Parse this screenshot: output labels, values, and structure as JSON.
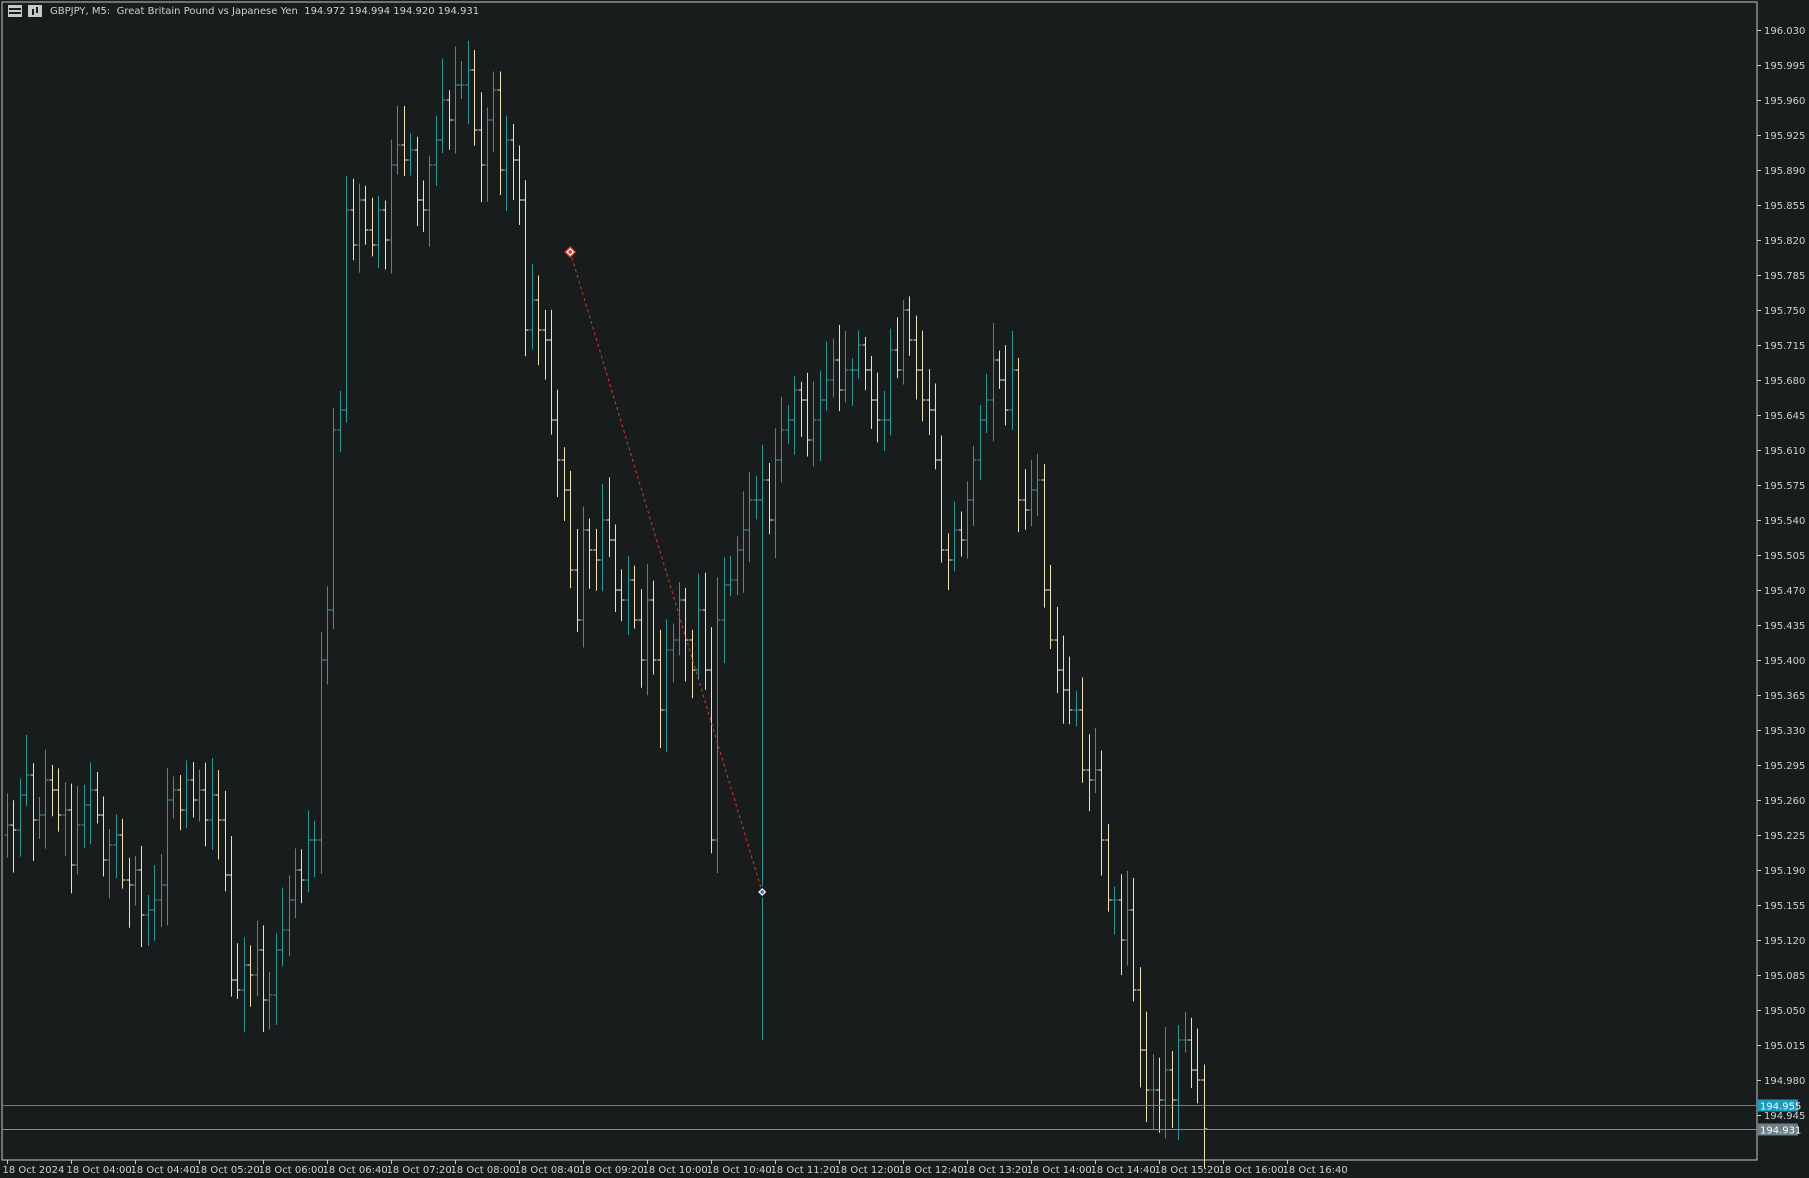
{
  "window": {
    "title": "GBPJPY, M5:  Great Britain Pound vs Japanese Yen  194.972 194.994 194.920 194.931",
    "menu_icon": "window-menu-icon",
    "chart_icon": "chart-type-icon"
  },
  "colors": {
    "background": "#181c1d",
    "axis": "#c8c8c8",
    "bull": "#2e9a94",
    "bear": "#efe3b8",
    "bid_line": "#1a9bc0",
    "ask_line": "#7f8f96",
    "bid_tag": "#1a9bc0",
    "ask_tag": "#6f7f86",
    "trade_line": "#d23a28"
  },
  "price_lines": {
    "bid": 194.955,
    "bid_label": "194.955",
    "ask": 194.931,
    "ask_label": "194.931"
  },
  "trade": {
    "open_marker": "sell-entry-icon",
    "close_marker": "exit-icon",
    "open_price": 195.808,
    "open_bar": 88,
    "close_price": 195.168,
    "close_bar": 118
  },
  "chart_data": {
    "type": "ohlc",
    "symbol": "GBPJPY",
    "timeframe": "M5",
    "ylim": [
      194.92,
      196.05
    ],
    "y_ticks": [
      "196.030",
      "195.995",
      "195.960",
      "195.925",
      "195.890",
      "195.855",
      "195.820",
      "195.785",
      "195.750",
      "195.715",
      "195.680",
      "195.645",
      "195.610",
      "195.575",
      "195.540",
      "195.505",
      "195.470",
      "195.435",
      "195.400",
      "195.365",
      "195.330",
      "195.295",
      "195.260",
      "195.225",
      "195.190",
      "195.155",
      "195.120",
      "195.085",
      "195.050",
      "195.015",
      "194.980",
      "194.945"
    ],
    "x_labels": [
      {
        "bar": 0,
        "label": "18 Oct 2024"
      },
      {
        "bar": 10,
        "label": "18 Oct 04:00"
      },
      {
        "bar": 20,
        "label": "18 Oct 04:40"
      },
      {
        "bar": 30,
        "label": "18 Oct 05:20"
      },
      {
        "bar": 40,
        "label": "18 Oct 06:00"
      },
      {
        "bar": 50,
        "label": "18 Oct 06:40"
      },
      {
        "bar": 60,
        "label": "18 Oct 07:20"
      },
      {
        "bar": 70,
        "label": "18 Oct 08:00"
      },
      {
        "bar": 80,
        "label": "18 Oct 08:40"
      },
      {
        "bar": 90,
        "label": "18 Oct 09:20"
      },
      {
        "bar": 100,
        "label": "18 Oct 10:00"
      },
      {
        "bar": 110,
        "label": "18 Oct 10:40"
      },
      {
        "bar": 120,
        "label": "18 Oct 11:20"
      },
      {
        "bar": 130,
        "label": "18 Oct 12:00"
      },
      {
        "bar": 140,
        "label": "18 Oct 12:40"
      },
      {
        "bar": 150,
        "label": "18 Oct 13:20"
      },
      {
        "bar": 160,
        "label": "18 Oct 14:00"
      },
      {
        "bar": 170,
        "label": "18 Oct 14:40"
      },
      {
        "bar": 180,
        "label": "18 Oct 15:20"
      },
      {
        "bar": 190,
        "label": "18 Oct 16:00"
      },
      {
        "bar": 200,
        "label": "18 Oct 16:40"
      }
    ],
    "close": [
      195.235,
      195.23,
      195.265,
      195.285,
      195.24,
      195.245,
      195.28,
      195.27,
      195.245,
      195.25,
      195.195,
      195.235,
      195.255,
      195.27,
      195.245,
      195.2,
      195.215,
      195.225,
      195.18,
      195.175,
      195.19,
      195.145,
      195.15,
      195.16,
      195.175,
      195.26,
      195.27,
      195.25,
      195.28,
      195.26,
      195.27,
      195.24,
      195.265,
      195.24,
      195.185,
      195.08,
      195.07,
      195.095,
      195.085,
      195.11,
      195.06,
      195.065,
      195.11,
      195.13,
      195.16,
      195.19,
      195.18,
      195.22,
      195.22,
      195.4,
      195.45,
      195.63,
      195.65,
      195.85,
      195.815,
      195.86,
      195.83,
      195.815,
      195.85,
      195.82,
      195.895,
      195.915,
      195.9,
      195.91,
      195.86,
      195.85,
      195.895,
      195.92,
      195.96,
      195.94,
      195.975,
      195.975,
      195.99,
      195.93,
      195.895,
      195.94,
      195.97,
      195.89,
      195.92,
      195.9,
      195.86,
      195.73,
      195.76,
      195.73,
      195.72,
      195.64,
      195.6,
      195.57,
      195.49,
      195.44,
      195.53,
      195.51,
      195.5,
      195.54,
      195.52,
      195.47,
      195.46,
      195.48,
      195.44,
      195.4,
      195.46,
      195.4,
      195.35,
      195.41,
      195.42,
      195.46,
      195.42,
      195.39,
      195.45,
      195.39,
      195.22,
      195.44,
      195.475,
      195.48,
      195.51,
      195.53,
      195.56,
      195.56,
      195.58,
      195.54,
      195.6,
      195.63,
      195.64,
      195.67,
      195.66,
      195.62,
      195.64,
      195.66,
      195.68,
      195.7,
      195.67,
      195.69,
      195.69,
      195.715,
      195.69,
      195.66,
      195.64,
      195.64,
      195.71,
      195.69,
      195.75,
      195.72,
      195.69,
      195.66,
      195.65,
      195.6,
      195.51,
      195.5,
      195.53,
      195.52,
      195.56,
      195.6,
      195.64,
      195.66,
      195.7,
      195.68,
      195.65,
      195.69,
      195.56,
      195.55,
      195.57,
      195.58,
      195.47,
      195.42,
      195.39,
      195.37,
      195.35,
      195.35,
      195.29,
      195.28,
      195.29,
      195.22,
      195.16,
      195.16,
      195.12,
      195.15,
      195.07,
      195.01,
      194.97,
      194.97,
      194.96,
      194.99,
      194.96,
      195.02,
      195.02,
      194.99,
      194.98,
      194.931
    ],
    "bar_count": 196,
    "bar_pixel_spacing_note": ""
  }
}
